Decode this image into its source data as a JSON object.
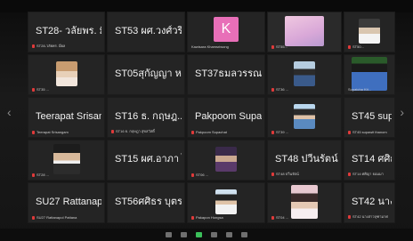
{
  "tiles": [
    {
      "id": "r1c1",
      "name": "ST28- วลัยพร. มี...",
      "caption": "ST28-วลัยพร. มีผล"
    },
    {
      "id": "r1c2",
      "name": "ST53 ผศ.วงศ์วริศ...",
      "caption": ""
    },
    {
      "id": "r1c3",
      "avatar": "K",
      "caption": "Kawisara Khamsriwong"
    },
    {
      "id": "r1c4",
      "caption": "ST55..."
    },
    {
      "id": "r1c5",
      "caption": "ST50..."
    },
    {
      "id": "r2c1",
      "caption": "ST35 ..."
    },
    {
      "id": "r2c2",
      "name": "ST05สุกัญญา ห...",
      "caption": ""
    },
    {
      "id": "r2c3",
      "name": "ST37ธมลวรรณ...",
      "caption": ""
    },
    {
      "id": "r2c4",
      "caption": "ST36 ..."
    },
    {
      "id": "r2c5",
      "caption": "Supatcha Kit..."
    },
    {
      "id": "r3c1",
      "name": "Teerapat Srisang...",
      "caption": "Teerapat Srisangam"
    },
    {
      "id": "r3c2",
      "name": "ST16 ธ. กฤษฎ...",
      "caption": "ST16 ธ. กฤษฎา สุขสวัสดิ์"
    },
    {
      "id": "r3c3",
      "name": "Pakpoom Supac...",
      "caption": "Pakpoom Supachat"
    },
    {
      "id": "r3c4",
      "caption": "ST39 ..."
    },
    {
      "id": "r3c5",
      "name": "ST45 supawit th...",
      "caption": "ST45 supawit thanom"
    },
    {
      "id": "r4c1",
      "caption": "ST28 ..."
    },
    {
      "id": "r4c2",
      "name": "ST15 ผศ.อาภา ไ...",
      "caption": ""
    },
    {
      "id": "r4c3",
      "caption": "ST06 ..."
    },
    {
      "id": "r4c4",
      "name": "ST48 ปวีนรัตน์...",
      "caption": "ST48 ปวีนรัตน์"
    },
    {
      "id": "r4c5",
      "name": "ST14 ศศิญา ธอ...",
      "caption": "ST14 ศศิญา ธอมมา"
    },
    {
      "id": "r5c1",
      "name": "SU27 Rattanapol...",
      "caption": "SU27 Rattanapol Pattana"
    },
    {
      "id": "r5c2",
      "name": "ST56ศศิธร บุตรศรี",
      "caption": ""
    },
    {
      "id": "r5c3",
      "caption": "Pakapon Hongsa"
    },
    {
      "id": "r5c4",
      "caption": "ST04 ..."
    },
    {
      "id": "r5c5",
      "name": "ST42 นางสาวจุ...",
      "caption": "ST42 นางสาวจุฑามาศ"
    }
  ],
  "nav": {
    "left_arrow": "‹",
    "right_arrow": "›"
  },
  "colors": {
    "tile_bg": "#242424",
    "avatar_k": "#e86fb8",
    "mic_muted": "#e03a3a"
  }
}
